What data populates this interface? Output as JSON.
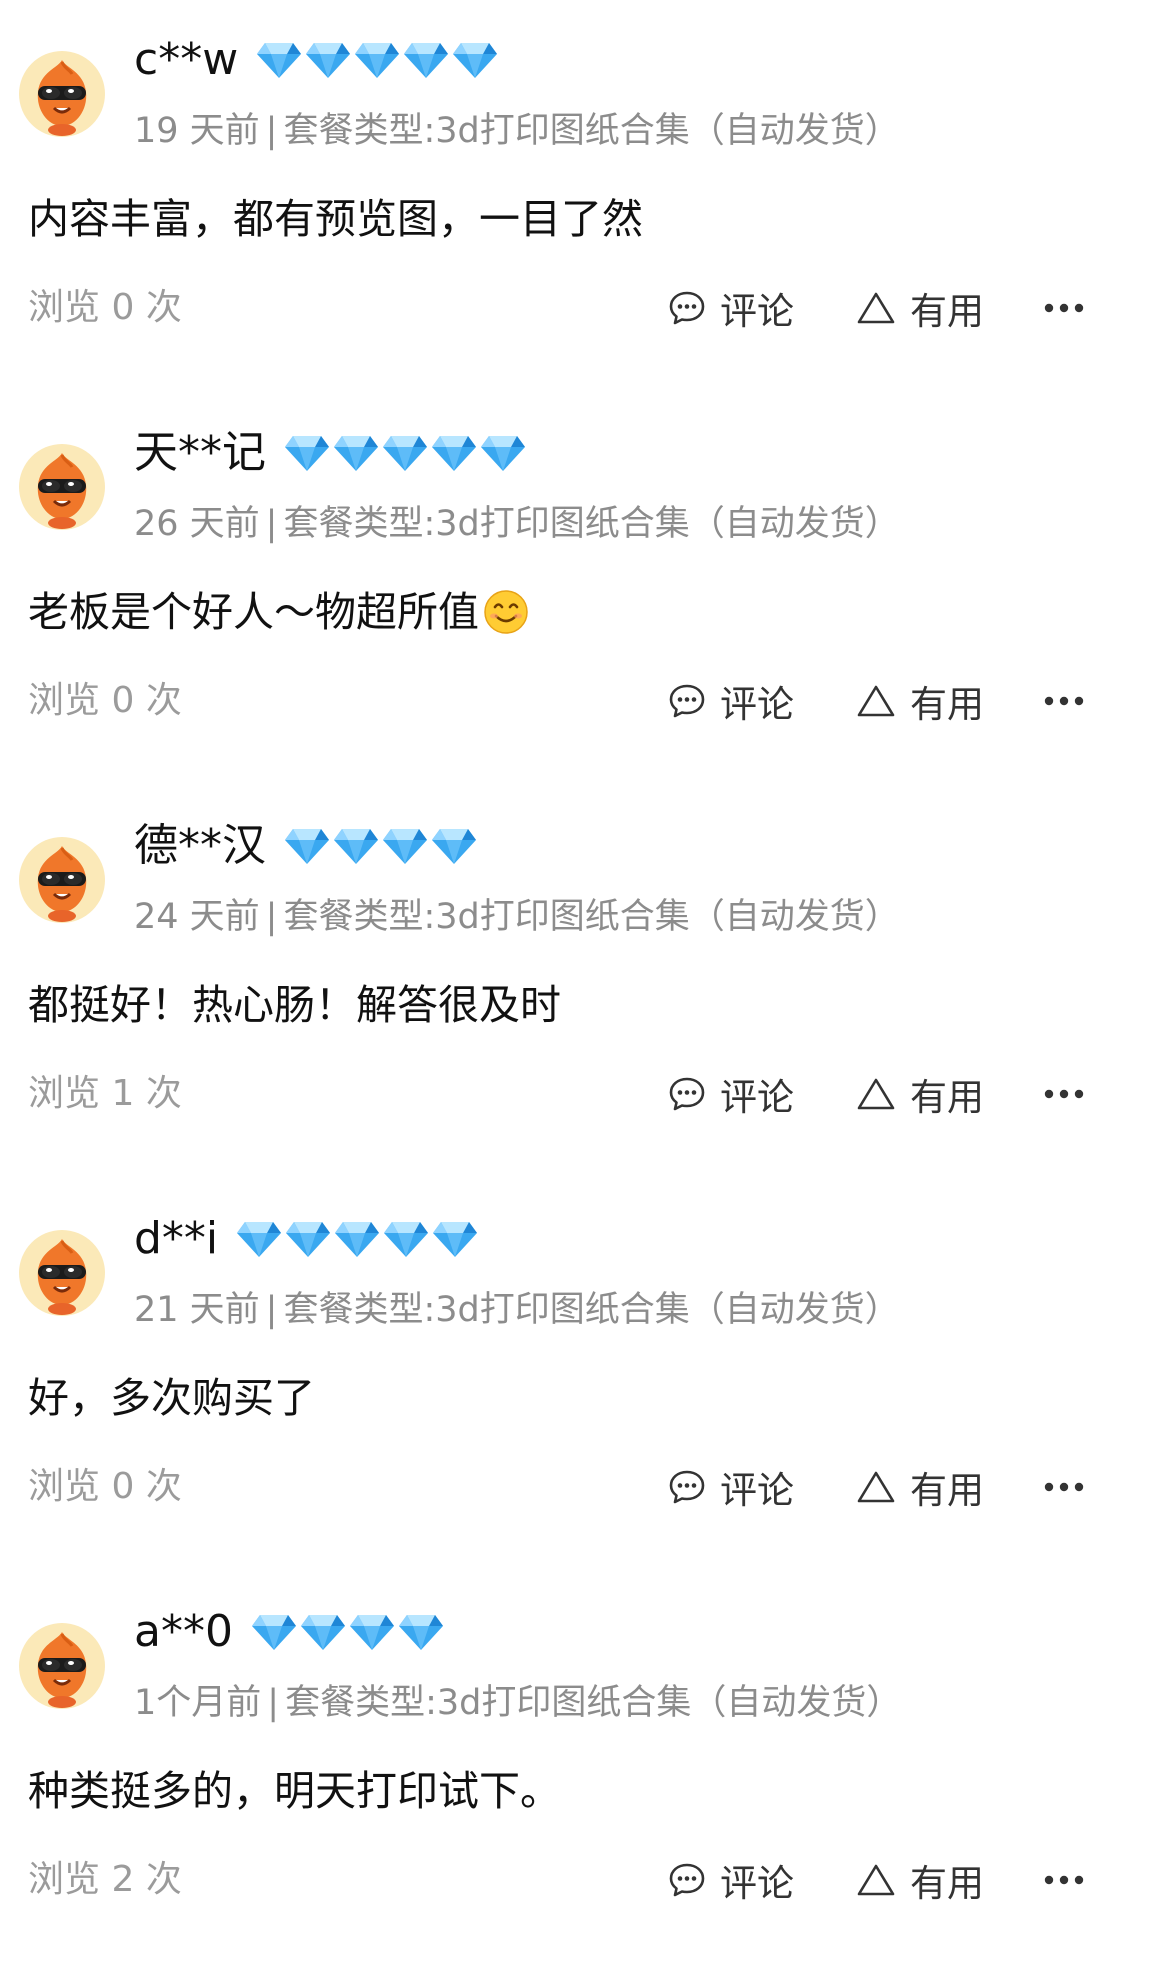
{
  "labels": {
    "views_prefix": "浏览",
    "views_suffix": "次",
    "separator": "|",
    "comment": "评论",
    "useful": "有用"
  },
  "icons": {
    "diamond": "diamond-icon",
    "comment": "chat-bubble-icon",
    "useful": "triangle-icon",
    "more": "ellipsis-icon"
  },
  "colors": {
    "diamond": "#3aa8f0",
    "meta_text": "#8c8c8c",
    "avatar_bg": "#fbe9b8",
    "mascot": "#f0772a"
  },
  "reviews": [
    {
      "username": "c**w",
      "diamonds": 5,
      "time": "19 天前",
      "package": "套餐类型:3d打印图纸合集（自动发货）",
      "content": "内容丰富，都有预览图，一目了然",
      "views": "0",
      "has_emoji": false
    },
    {
      "username": "天**记",
      "diamonds": 5,
      "time": "26 天前",
      "package": "套餐类型:3d打印图纸合集（自动发货）",
      "content": "老板是个好人～物超所值",
      "views": "0",
      "has_emoji": true,
      "emoji": "smiling-face-emoji"
    },
    {
      "username": "德**汉",
      "diamonds": 4,
      "time": "24 天前",
      "package": "套餐类型:3d打印图纸合集（自动发货）",
      "content": "都挺好！热心肠！解答很及时",
      "views": "1",
      "has_emoji": false
    },
    {
      "username": "d**i",
      "diamonds": 5,
      "time": "21 天前",
      "package": "套餐类型:3d打印图纸合集（自动发货）",
      "content": "好，多次购买了",
      "views": "0",
      "has_emoji": false
    },
    {
      "username": "a**0",
      "diamonds": 4,
      "time": "1个月前",
      "package": "套餐类型:3d打印图纸合集（自动发货）",
      "content": "种类挺多的，明天打印试下。",
      "views": "2",
      "has_emoji": false
    }
  ]
}
